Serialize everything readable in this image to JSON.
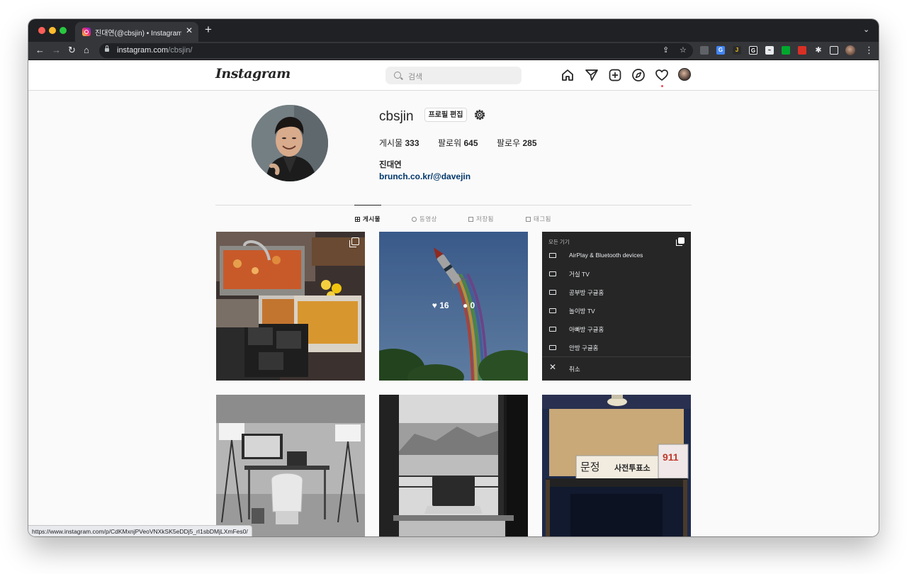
{
  "browser": {
    "tab_title": "진대연(@cbsjin) • Instagram 사진 및 동영상",
    "url_host": "instagram.com",
    "url_path": "/cbsjin/",
    "new_tab_label": "+",
    "tab_close_label": "✕",
    "status_url": "https://www.instagram.com/p/CdKMxnjPVeoVNXkSK5eDDj5_rI1sbDMjLXmFes0/"
  },
  "header": {
    "logo_text": "Instagram",
    "search_placeholder": "검색"
  },
  "profile": {
    "username": "cbsjin",
    "edit_button": "프로필 편집",
    "posts_label": "게시물",
    "posts_count": "333",
    "followers_label": "팔로워",
    "followers_count": "645",
    "following_label": "팔로우",
    "following_count": "285",
    "full_name": "진대연",
    "link": "brunch.co.kr/@davejin"
  },
  "tabs": [
    {
      "label": "게시물",
      "active": true
    },
    {
      "label": "동영상",
      "active": false
    },
    {
      "label": "저장됨",
      "active": false
    },
    {
      "label": "태그됨",
      "active": false
    }
  ],
  "posts": {
    "hover_likes": "16",
    "hover_comments": "0"
  },
  "cast_menu": {
    "heading": "모든 기기",
    "items": [
      "AirPlay & Bluetooth devices",
      "거실 TV",
      "공부방 구글홈",
      "놀이방 TV",
      "아빠방 구글홈",
      "안방 구글홈"
    ],
    "cancel": "취소"
  },
  "photo_text": {
    "sign_left": "문정",
    "sign_right": "사전투표소",
    "badge_number": "911"
  }
}
